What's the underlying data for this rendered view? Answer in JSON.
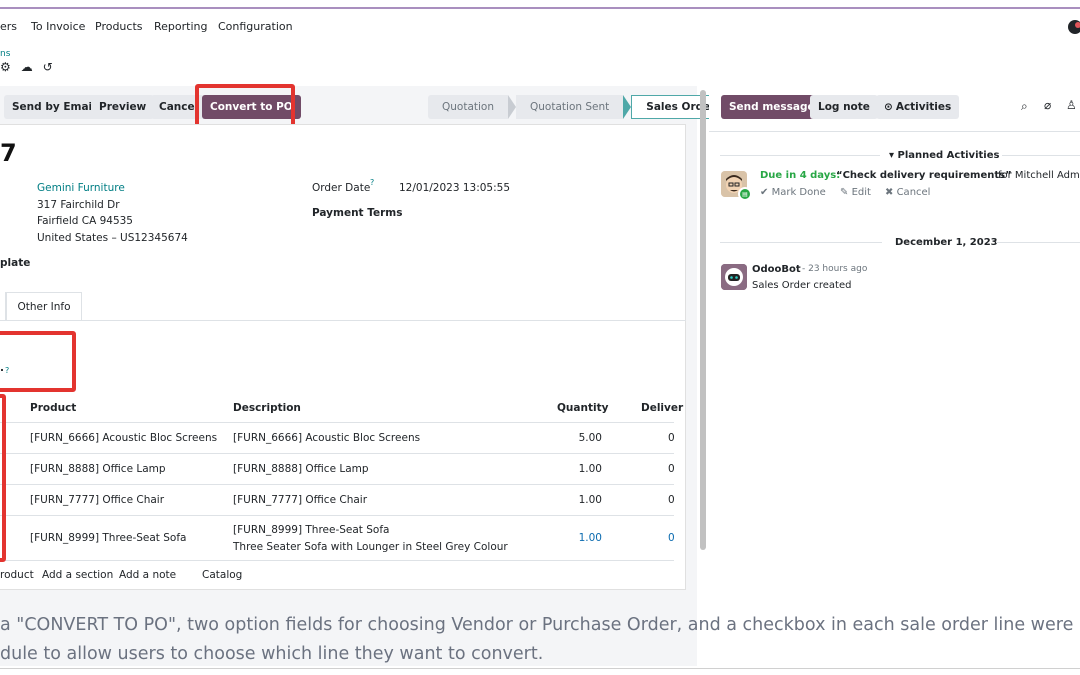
{
  "navbar": {
    "items": [
      "ers",
      "To Invoice",
      "Products",
      "Reporting",
      "Configuration"
    ]
  },
  "breadcrumb": {
    "parent": "ns"
  },
  "record_icons": {
    "gear": "⚙",
    "save": "☁",
    "discard": "↺"
  },
  "actions": {
    "send_email": "Send by Email",
    "preview": "Preview",
    "cancel": "Cancel",
    "convert_po": "Convert to PO"
  },
  "status": {
    "stages": [
      "Quotation",
      "Quotation Sent",
      "Sales Order"
    ],
    "active": "Sales Order"
  },
  "order": {
    "name_fragment": "7",
    "customer": {
      "name": "Gemini Furniture",
      "street": "317 Fairchild Dr",
      "city": "Fairfield CA 94535",
      "country": "United States – US12345674"
    },
    "order_date_label": "Order Date",
    "order_date_help": "?",
    "order_date_value": "12/01/2023 13:05:55",
    "payment_terms_label": "Payment Terms",
    "template_label_fragment": "plate",
    "vendor_field_fragment": ".",
    "vendor_field_help": "?"
  },
  "tabs": {
    "other_info": "Other Info"
  },
  "lines": {
    "headers": {
      "product": "Product",
      "description": "Description",
      "quantity": "Quantity",
      "delivered": "Deliver"
    },
    "rows": [
      {
        "product": "[FURN_6666] Acoustic Bloc Screens",
        "description": "[FURN_6666] Acoustic Bloc Screens",
        "description2": "",
        "quantity": "5.00",
        "delivered": "0"
      },
      {
        "product": "[FURN_8888] Office Lamp",
        "description": "[FURN_8888] Office Lamp",
        "description2": "",
        "quantity": "1.00",
        "delivered": "0"
      },
      {
        "product": "[FURN_7777] Office Chair",
        "description": "[FURN_7777] Office Chair",
        "description2": "",
        "quantity": "1.00",
        "delivered": "0"
      },
      {
        "product": "[FURN_8999] Three-Seat Sofa",
        "description": "[FURN_8999] Three-Seat Sofa",
        "description2": "Three Seater Sofa with Lounger in Steel Grey Colour",
        "quantity": "1.00",
        "delivered": "0"
      }
    ],
    "add_product": "roduct",
    "add_section": "Add a section",
    "add_note": "Add a note",
    "catalog": "Catalog"
  },
  "chatter": {
    "send_message": "Send message",
    "log_note": "Log note",
    "activities": "Activities",
    "planned_activities": "Planned Activities",
    "activity": {
      "due": "Due in 4 days:",
      "summary": "“Check delivery requirements”",
      "for_user": "for Mitchell Admi",
      "mark_done": "Mark Done",
      "edit": "Edit",
      "cancel": "Cancel"
    },
    "date_separator": "December 1, 2023",
    "message": {
      "author": "OdooBot",
      "time": "- 23 hours ago",
      "body": "Sales Order created"
    }
  },
  "caption": {
    "line1": "a \"CONVERT TO PO\", two option fields for choosing Vendor or Purchase Order, and a checkbox in each sale order line were",
    "line2": "dule to allow users to choose which line they want to convert."
  },
  "colors": {
    "brand": "#714b67",
    "link": "#017e84",
    "highlight": "#e3342f",
    "due": "#28a745",
    "qty_blue": "#0c6cb0"
  }
}
